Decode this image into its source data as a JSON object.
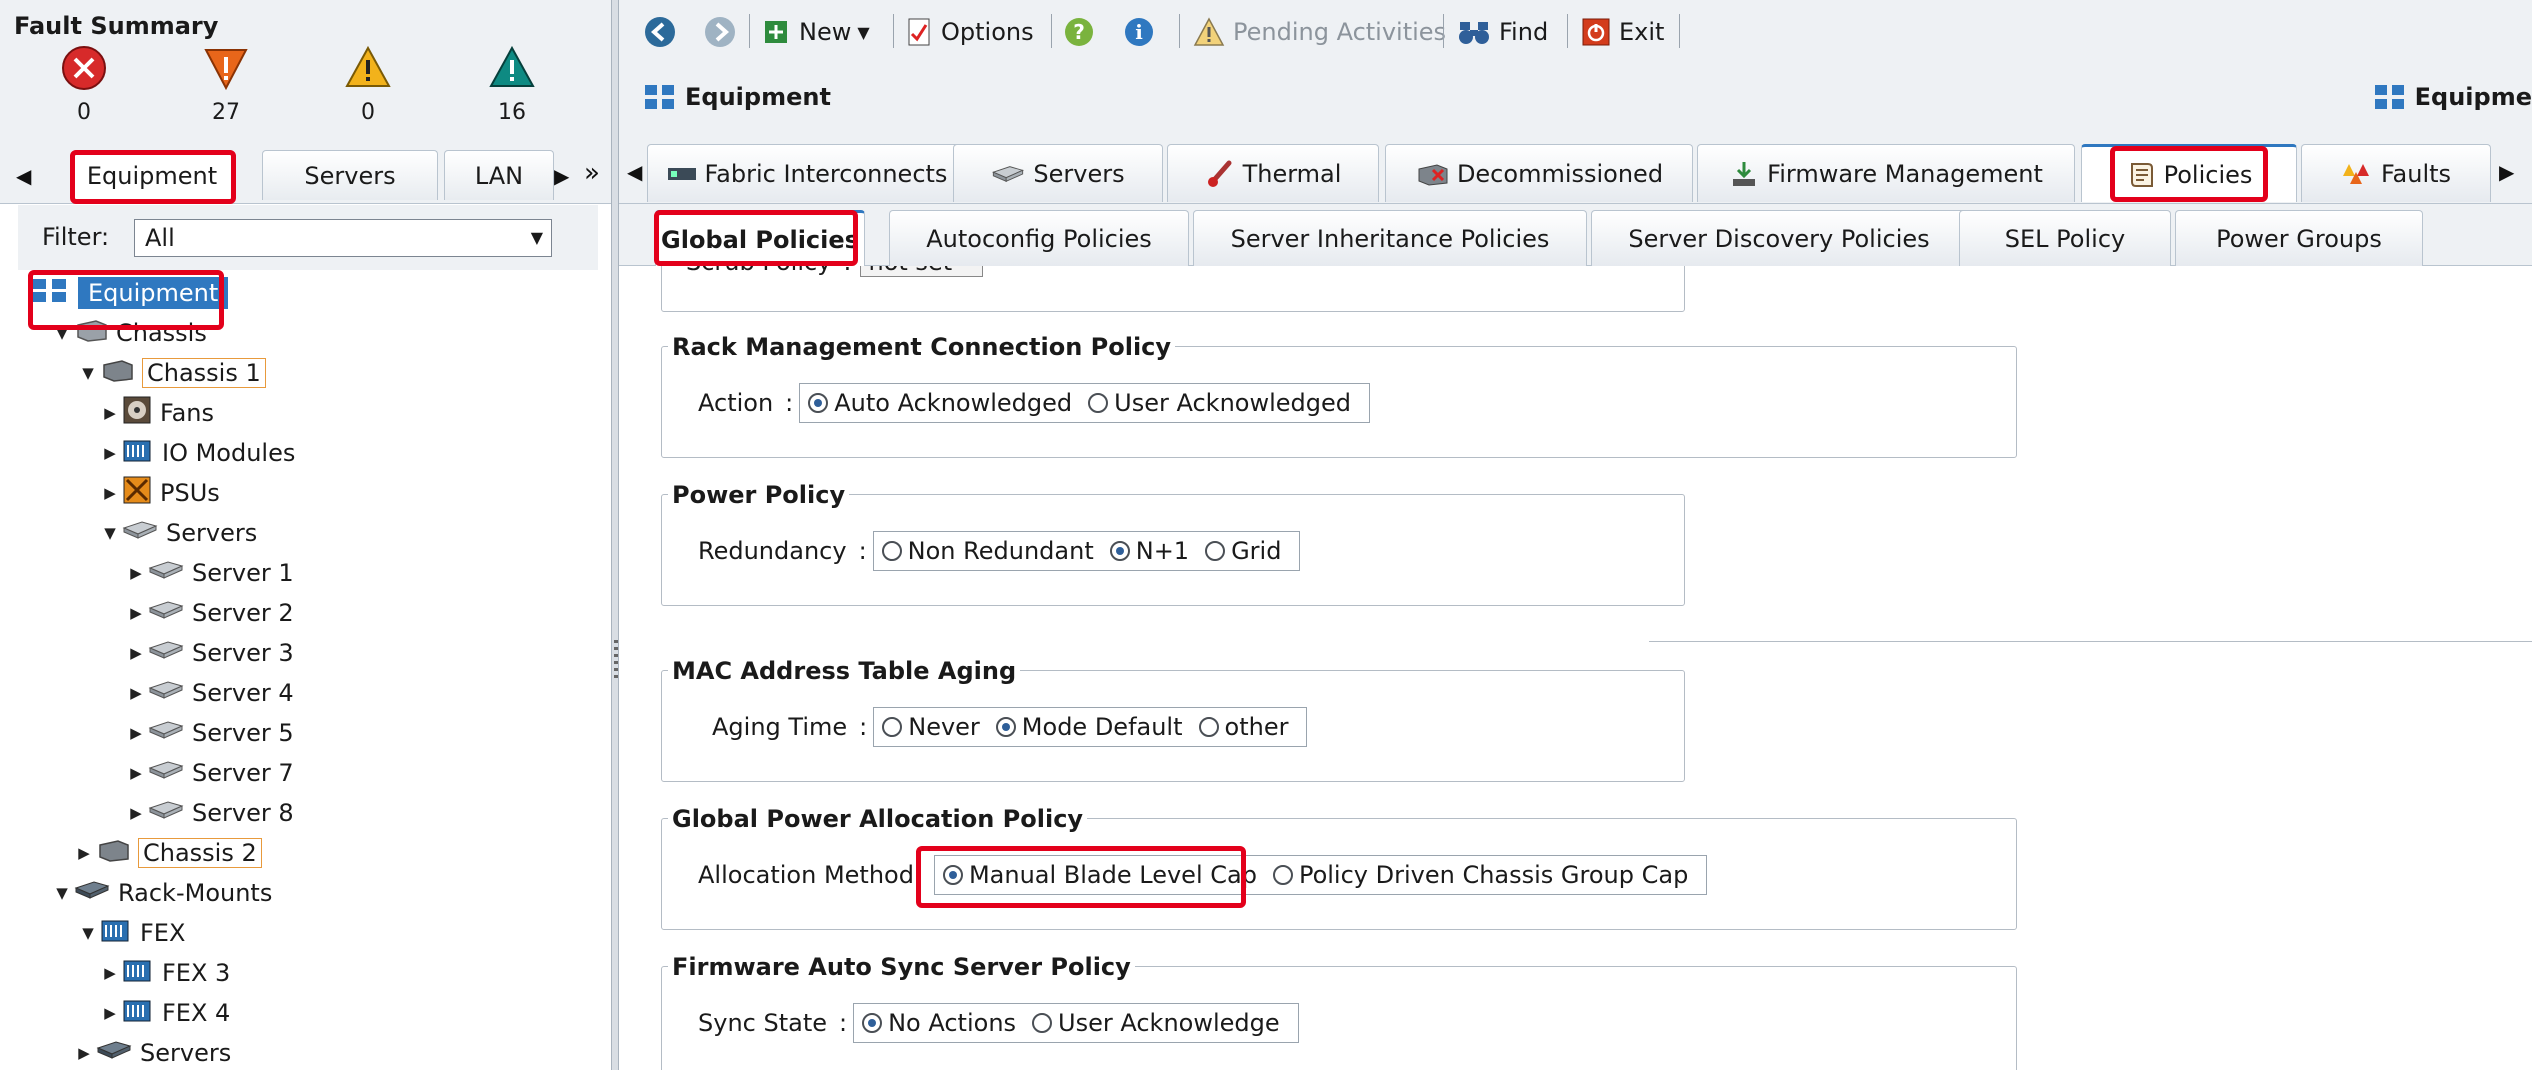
{
  "fault_summary": {
    "title": "Fault Summary",
    "items": [
      {
        "name": "critical",
        "count": "0",
        "color": "#d72a2a"
      },
      {
        "name": "major",
        "count": "27",
        "color": "#e8661a"
      },
      {
        "name": "minor",
        "count": "0",
        "color": "#f2b21b"
      },
      {
        "name": "warning",
        "count": "16",
        "color": "#0e8a82"
      }
    ]
  },
  "left_tabs": {
    "items": [
      "Equipment",
      "Servers",
      "LAN"
    ],
    "more": "»"
  },
  "filter": {
    "label": "Filter:",
    "value": "All"
  },
  "tree": {
    "root": "Equipment",
    "chassis": "Chassis",
    "chassis1": "Chassis 1",
    "fans": "Fans",
    "io_modules": "IO Modules",
    "psus": "PSUs",
    "servers": "Servers",
    "server_items": [
      "Server 1",
      "Server 2",
      "Server 3",
      "Server 4",
      "Server 5",
      "Server 7",
      "Server 8"
    ],
    "chassis2": "Chassis 2",
    "rack_mounts": "Rack-Mounts",
    "fex": "FEX",
    "fex_items": [
      "FEX 3",
      "FEX 4"
    ],
    "rack_servers": "Servers"
  },
  "toolbar": {
    "new": "New",
    "options": "Options",
    "pending": "Pending Activities",
    "find": "Find",
    "exit": "Exit"
  },
  "header": {
    "title": "Equipment",
    "right_title": "Equipme"
  },
  "main_tabs": [
    "Fabric Interconnects",
    "Servers",
    "Thermal",
    "Decommissioned",
    "Firmware Management",
    "Policies",
    "Faults"
  ],
  "sub_tabs": [
    "Global Policies",
    "Autoconfig Policies",
    "Server Inheritance Policies",
    "Server Discovery Policies",
    "SEL Policy",
    "Power Groups"
  ],
  "policies": {
    "scrub": {
      "label": "Scrub Policy",
      "value": "not set"
    },
    "rack_mgmt": {
      "title": "Rack Management Connection Policy",
      "field": "Action",
      "options": [
        "Auto Acknowledged",
        "User Acknowledged"
      ],
      "selected": 0
    },
    "power": {
      "title": "Power Policy",
      "field": "Redundancy",
      "options": [
        "Non Redundant",
        "N+1",
        "Grid"
      ],
      "selected": 1
    },
    "mac": {
      "title": "MAC Address Table Aging",
      "field": "Aging Time",
      "options": [
        "Never",
        "Mode Default",
        "other"
      ],
      "selected": 1
    },
    "global_power": {
      "title": "Global Power Allocation Policy",
      "field": "Allocation Method",
      "options": [
        "Manual Blade Level Cap",
        "Policy Driven Chassis Group Cap"
      ],
      "selected": 0
    },
    "firmware_sync": {
      "title": "Firmware Auto Sync Server Policy",
      "field": "Sync State",
      "options": [
        "No Actions",
        "User Acknowledge"
      ],
      "selected": 0
    }
  },
  "colors": {
    "accent": "#2f78c0",
    "highlight": "#e3001b",
    "panel": "#eef1f4"
  }
}
